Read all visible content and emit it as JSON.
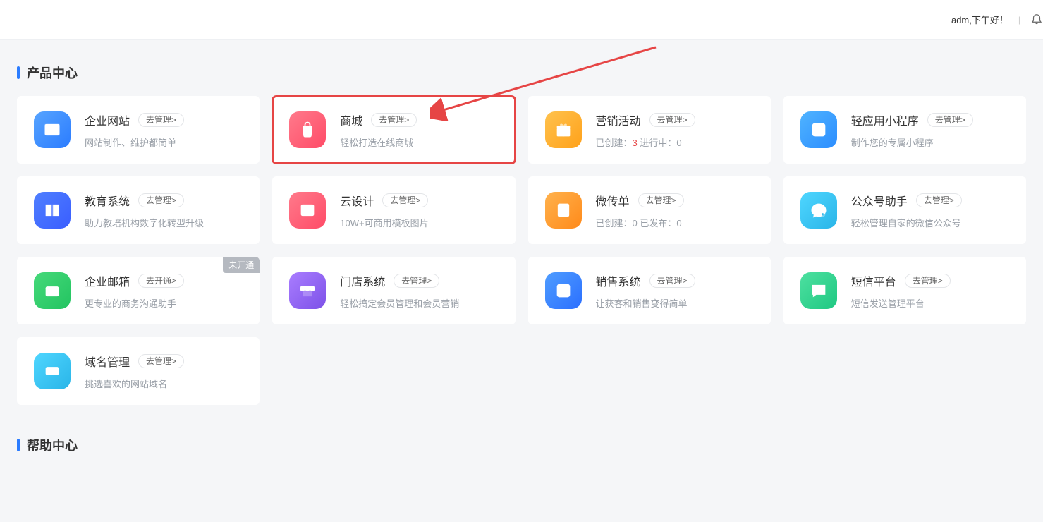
{
  "header": {
    "greeting": "adm,下午好！"
  },
  "sections": {
    "product_center": "产品中心",
    "help_center": "帮助中心"
  },
  "cards": [
    {
      "title": "企业网站",
      "btn": "去管理>",
      "desc": "网站制作、维护都简单"
    },
    {
      "title": "商城",
      "btn": "去管理>",
      "desc": "轻松打造在线商城"
    },
    {
      "title": "营销活动",
      "btn": "去管理>",
      "desc_parts": {
        "a": "已创建：",
        "av": "3",
        "b": "   进行中：",
        "bv": "0"
      }
    },
    {
      "title": "轻应用小程序",
      "btn": "去管理>",
      "desc": "制作您的专属小程序"
    },
    {
      "title": "教育系统",
      "btn": "去管理>",
      "desc": "助力教培机构数字化转型升级"
    },
    {
      "title": "云设计",
      "btn": "去管理>",
      "desc": "10W+可商用模板图片"
    },
    {
      "title": "微传单",
      "btn": "去管理>",
      "desc_parts": {
        "a": "已创建：",
        "av": "0",
        "b": "   已发布：",
        "bv": "0"
      }
    },
    {
      "title": "公众号助手",
      "btn": "去管理>",
      "desc": "轻松管理自家的微信公众号"
    },
    {
      "title": "企业邮箱",
      "btn": "去开通>",
      "desc": "更专业的商务沟通助手",
      "badge": "未开通"
    },
    {
      "title": "门店系统",
      "btn": "去管理>",
      "desc": "轻松搞定会员管理和会员营销"
    },
    {
      "title": "销售系统",
      "btn": "去管理>",
      "desc": "让获客和销售变得简单"
    },
    {
      "title": "短信平台",
      "btn": "去管理>",
      "desc": "短信发送管理平台"
    },
    {
      "title": "域名管理",
      "btn": "去管理>",
      "desc": "挑选喜欢的网站域名"
    }
  ]
}
